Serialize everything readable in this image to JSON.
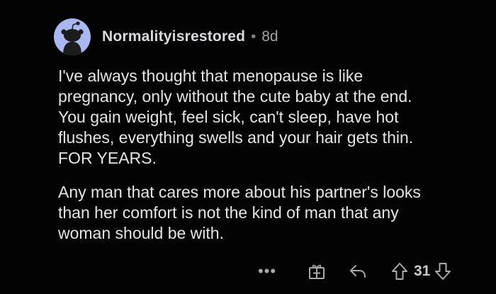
{
  "comment": {
    "username": "Normalityisrestored",
    "separator": "•",
    "age": "8d",
    "paragraphs": [
      "I've always thought that menopause is like\npregnancy, only without the cute baby at the end.\nYou gain weight, feel sick, can't sleep, have hot\nflushes, everything swells and your hair gets thin.\nFOR YEARS.",
      "Any man that cares more about his partner's looks\nthan her comfort is not the kind of man that any\nwoman should be with."
    ],
    "score": "31",
    "more_label": "•••"
  },
  "icons": {
    "avatar": "reddit-snoo-avatar",
    "award": "gift-award-icon",
    "reply": "reply-arrow-icon",
    "upvote": "arrow-up-icon",
    "downvote": "arrow-down-icon"
  },
  "colors": {
    "background": "#030303",
    "text": "#e2e4e6",
    "muted": "#a0a3a5",
    "avatar_bg": "#a9b8f0"
  }
}
